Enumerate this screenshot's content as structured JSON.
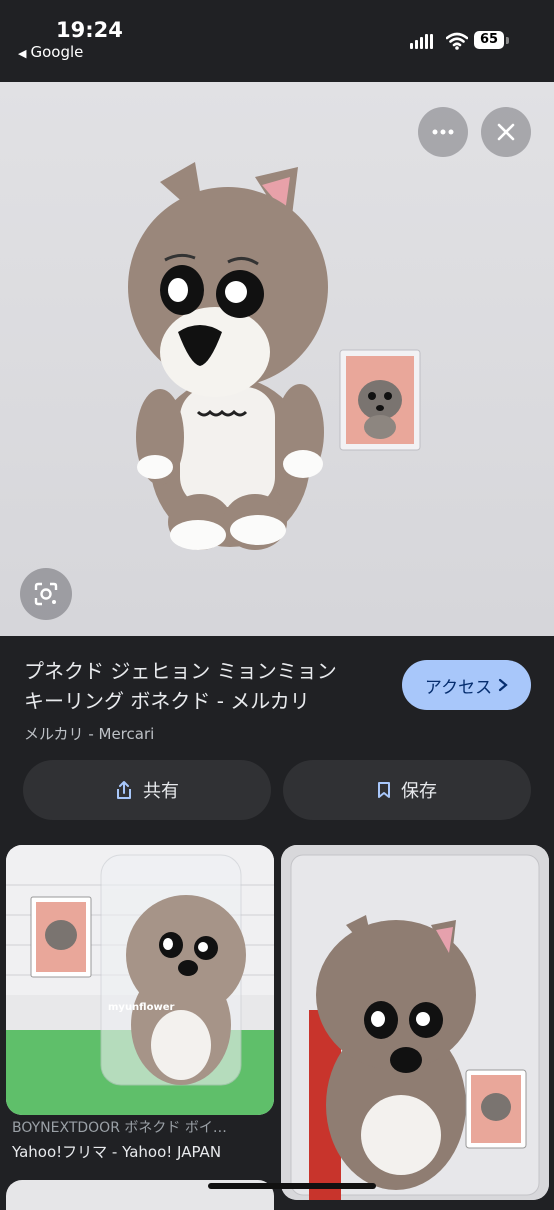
{
  "status_bar": {
    "time": "19:24",
    "back_label": "Google",
    "battery": "65"
  },
  "hero": {
    "more_icon": "more-horiz-icon",
    "close_icon": "close-icon",
    "lens_icon": "lens-icon"
  },
  "result": {
    "title_line1": "プネクド ジェヒョン ミョンミョン",
    "title_line2": "キーリング ボネクド - メルカリ",
    "source": "メルカリ - Mercari",
    "access_label": "アクセス",
    "share_label": "共有",
    "save_label": "保存"
  },
  "related": [
    {
      "title": "BOYNEXTDOOR ボネクド ボイ…",
      "source": "Yahoo!フリマ - Yahoo! JAPAN",
      "watermark": "myunflower"
    },
    {
      "title": "",
      "source": ""
    }
  ],
  "colors": {
    "background": "#202124",
    "accent": "#a8c7fa",
    "pill": "#303134"
  }
}
